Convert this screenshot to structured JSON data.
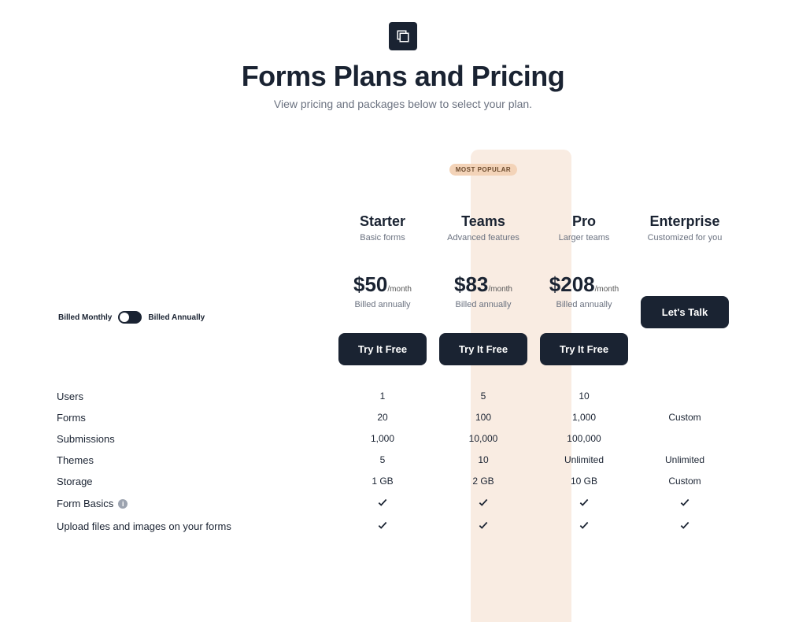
{
  "header": {
    "title": "Forms Plans and Pricing",
    "subtitle": "View pricing and packages below to select your plan."
  },
  "popular_badge": "MOST POPULAR",
  "billing": {
    "monthly": "Billed Monthly",
    "annually": "Billed Annually"
  },
  "plans": [
    {
      "name": "Starter",
      "desc": "Basic forms",
      "price": "$50",
      "unit": "/month",
      "note": "Billed annually",
      "cta": "Try It Free"
    },
    {
      "name": "Teams",
      "desc": "Advanced features",
      "price": "$83",
      "unit": "/month",
      "note": "Billed annually",
      "cta": "Try It Free"
    },
    {
      "name": "Pro",
      "desc": "Larger teams",
      "price": "$208",
      "unit": "/month",
      "note": "Billed annually",
      "cta": "Try It Free"
    },
    {
      "name": "Enterprise",
      "desc": "Customized for you",
      "price": "",
      "unit": "",
      "note": "",
      "cta": "Let's Talk"
    }
  ],
  "features": [
    {
      "label": "Users",
      "vals": [
        "1",
        "5",
        "10",
        ""
      ]
    },
    {
      "label": "Forms",
      "vals": [
        "20",
        "100",
        "1,000",
        "Custom"
      ]
    },
    {
      "label": "Submissions",
      "vals": [
        "1,000",
        "10,000",
        "100,000",
        ""
      ]
    },
    {
      "label": "Themes",
      "vals": [
        "5",
        "10",
        "Unlimited",
        "Unlimited"
      ]
    },
    {
      "label": "Storage",
      "vals": [
        "1 GB",
        "2 GB",
        "10 GB",
        "Custom"
      ]
    },
    {
      "label": "Form Basics",
      "info": true,
      "vals": [
        "check",
        "check",
        "check",
        "check"
      ]
    },
    {
      "label": "Upload files and images on your forms",
      "vals": [
        "check",
        "check",
        "check",
        "check"
      ]
    }
  ]
}
